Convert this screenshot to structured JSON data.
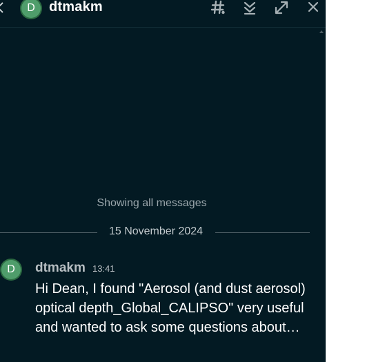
{
  "header": {
    "title": "dtmakm",
    "avatar_initial": "D",
    "icons": [
      "back-chevron-icon",
      "hashtag-icon",
      "jump-to-latest-icon",
      "expand-icon",
      "close-icon"
    ]
  },
  "conversation": {
    "history_status": "Showing all messages",
    "date_divider": "15 November 2024",
    "messages": [
      {
        "avatar_initial": "D",
        "author": "dtmakm",
        "time": "13:41",
        "text": "Hi Dean, I found \"Aerosol (and dust aerosol) optical depth_Global_CALIPSO\" very useful and wanted to ask some questions about…"
      }
    ]
  },
  "colors": {
    "panel_background": "#031a23",
    "avatar_green": "#4f9d6b",
    "muted_text": "#9aa6ab",
    "message_text": "#ffffff"
  }
}
